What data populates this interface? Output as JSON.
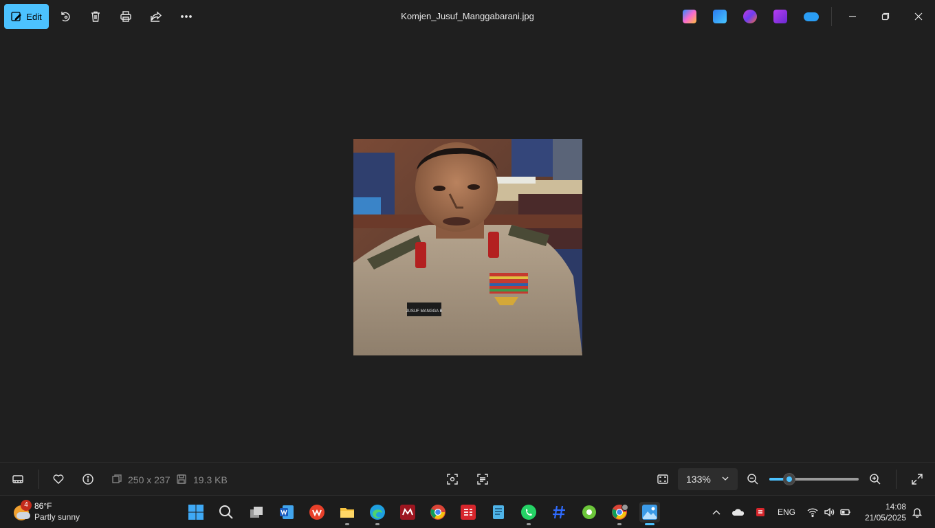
{
  "toolbar": {
    "edit_label": "Edit",
    "icons": [
      "rotate-icon",
      "delete-icon",
      "print-icon",
      "share-icon",
      "more-icon"
    ]
  },
  "window": {
    "title": "Komjen_Jusuf_Manggabarani.jpg"
  },
  "header_apps": [
    "copilot-icon",
    "designer-icon",
    "clipchamp-icon",
    "video-editor-icon",
    "onedrive-icon"
  ],
  "image": {
    "alt": "Photograph of a police officer in uniform",
    "name_tag_text": "JUSUF MANGGA B"
  },
  "footer": {
    "dimensions": "250 x 237",
    "file_size": "19.3 KB",
    "zoom": "133%",
    "zoom_fraction": 0.22
  },
  "taskbar": {
    "weather_badge": "4",
    "temperature": "86°F",
    "condition": "Partly sunny",
    "language": "ENG",
    "time": "14:08",
    "date": "21/05/2025"
  },
  "colors": {
    "accent": "#4cc2ff",
    "background": "#1f1f1f",
    "taskbar": "#1c1c1c"
  }
}
